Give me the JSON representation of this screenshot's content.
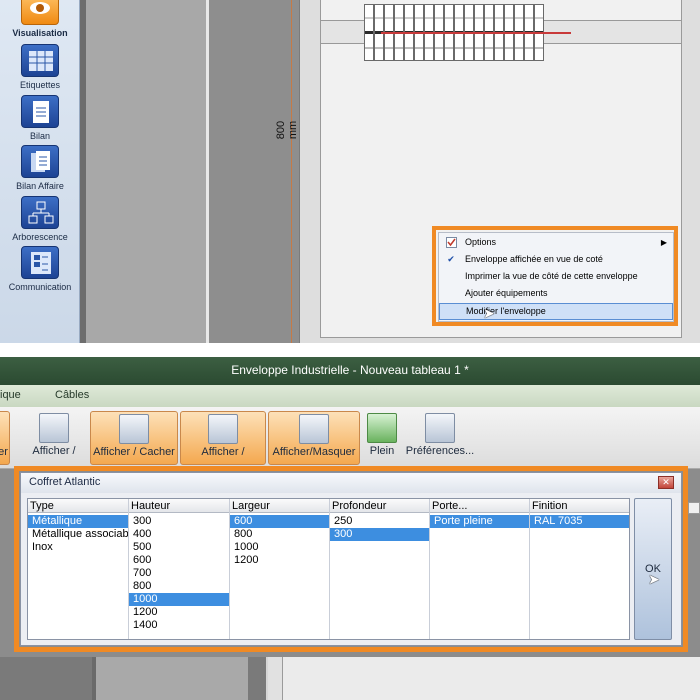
{
  "sidebar": {
    "items": [
      {
        "label": "Visualisation",
        "icon": "eye-icon",
        "active": true
      },
      {
        "label": "Etiquettes",
        "icon": "grid-icon"
      },
      {
        "label": "Bilan",
        "icon": "document-icon"
      },
      {
        "label": "Bilan Affaire",
        "icon": "documents-icon"
      },
      {
        "label": "Arborescence",
        "icon": "tree-icon"
      },
      {
        "label": "Communication",
        "icon": "communication-icon"
      }
    ]
  },
  "drawing": {
    "dimension": "800 mm"
  },
  "context_menu": {
    "items": [
      {
        "label": "Options",
        "icon": "options-icon",
        "submenu": true
      },
      {
        "label": "Enveloppe affichée en vue de coté",
        "checked": true
      },
      {
        "label": "Imprimer la vue de côté de cette enveloppe"
      },
      {
        "label": "Ajouter équipements"
      },
      {
        "label": "Modifier l'enveloppe",
        "hover": true
      }
    ]
  },
  "window": {
    "title": "Enveloppe Industrielle - Nouveau tableau 1 *"
  },
  "menubar": {
    "items": [
      "ique",
      "Câbles"
    ]
  },
  "ribbon": {
    "buttons": [
      {
        "label": "er"
      },
      {
        "label": "Afficher /"
      },
      {
        "label": "Afficher / Cacher"
      },
      {
        "label": "Afficher /"
      },
      {
        "label": "Afficher/Masquer"
      },
      {
        "label": "Plein"
      },
      {
        "label": "Préférences..."
      }
    ]
  },
  "dialog": {
    "title": "Coffret Atlantic",
    "ok_label": "OK",
    "columns": [
      {
        "header": "Type",
        "items": [
          "Métallique",
          "Métallique associable",
          "Inox"
        ],
        "selected": 0
      },
      {
        "header": "Hauteur",
        "items": [
          "300",
          "400",
          "500",
          "600",
          "700",
          "800",
          "1000",
          "1200",
          "1400"
        ],
        "selected": 6
      },
      {
        "header": "Largeur",
        "items": [
          "600",
          "800",
          "1000",
          "1200"
        ],
        "selected": 0
      },
      {
        "header": "Profondeur",
        "items": [
          "250",
          "300"
        ],
        "selected": 1
      },
      {
        "header": "Porte...",
        "items": [
          "Porte pleine"
        ],
        "selected": 0
      },
      {
        "header": "Finition",
        "items": [
          "RAL 7035"
        ],
        "selected": 0
      }
    ]
  },
  "colors": {
    "highlight": "#f08a24",
    "selection": "#3d8ee0"
  }
}
